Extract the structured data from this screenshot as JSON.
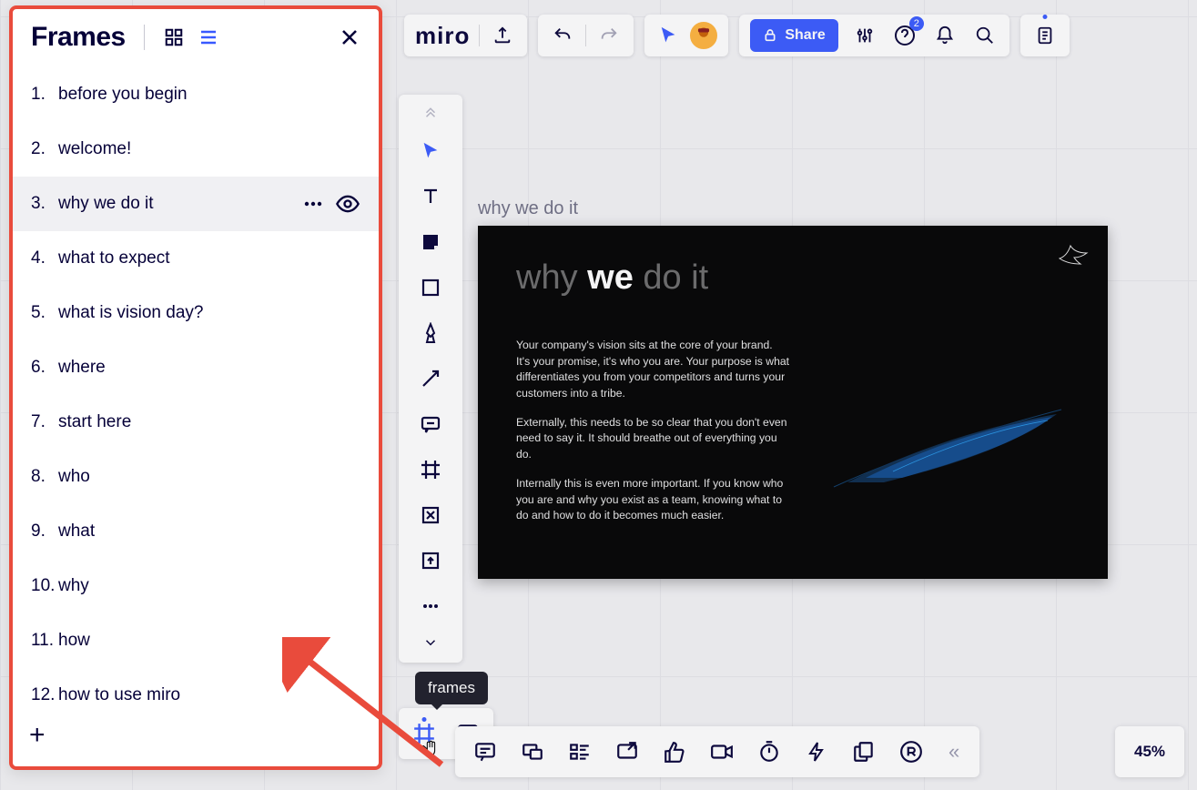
{
  "panel": {
    "title": "Frames",
    "items": [
      {
        "num": "1.",
        "label": "before you begin",
        "selected": false
      },
      {
        "num": "2.",
        "label": "welcome!",
        "selected": false
      },
      {
        "num": "3.",
        "label": "why we do it",
        "selected": true
      },
      {
        "num": "4.",
        "label": "what to expect",
        "selected": false
      },
      {
        "num": "5.",
        "label": "what is vision day?",
        "selected": false
      },
      {
        "num": "6.",
        "label": "where",
        "selected": false
      },
      {
        "num": "7.",
        "label": "start here",
        "selected": false
      },
      {
        "num": "8.",
        "label": "who",
        "selected": false
      },
      {
        "num": "9.",
        "label": "what",
        "selected": false
      },
      {
        "num": "10.",
        "label": "why",
        "selected": false
      },
      {
        "num": "11.",
        "label": "how",
        "selected": false
      },
      {
        "num": "12.",
        "label": "how to use miro",
        "selected": false
      }
    ]
  },
  "topbar": {
    "logo": "miro",
    "share_label": "Share",
    "help_badge": "2"
  },
  "tooltip": {
    "frames": "frames"
  },
  "zoom": "45%",
  "canvas": {
    "frame_label": "why we do it",
    "slide_title_a": "why ",
    "slide_title_b": "we",
    "slide_title_c": " do it",
    "p1": "Your company's vision sits at the core of your brand. It's your promise, it's who you are. Your purpose is what differentiates you from your competitors and turns your customers into a tribe.",
    "p2": "Externally, this needs to be so clear that you don't even need to say it. It should breathe out of everything you do.",
    "p3": "Internally this is even more important. If you know who you are and why you exist as a team, knowing what to do and how to do it becomes much easier."
  }
}
